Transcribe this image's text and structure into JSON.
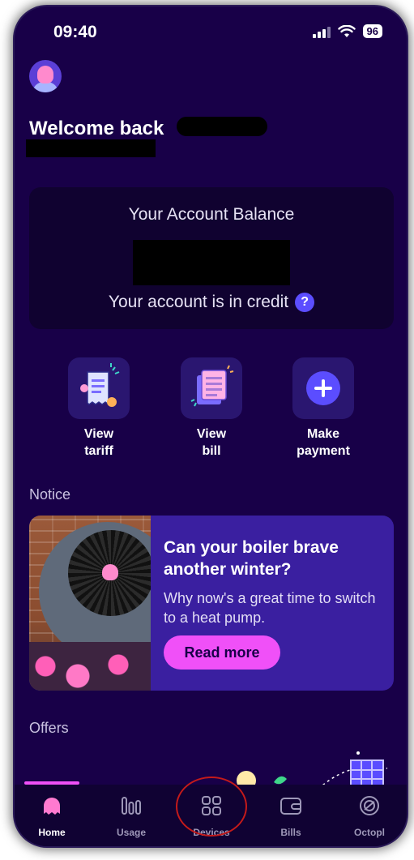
{
  "status_bar": {
    "time": "09:40",
    "battery": "96"
  },
  "header": {
    "welcome_text": "Welcome back"
  },
  "balance_card": {
    "title": "Your Account Balance",
    "status_text": "Your account is in credit",
    "help_icon": "?"
  },
  "quick_actions": [
    {
      "label_line1": "View",
      "label_line2": "tariff",
      "icon": "receipt-icon"
    },
    {
      "label_line1": "View",
      "label_line2": "bill",
      "icon": "bill-document-icon"
    },
    {
      "label_line1": "Make",
      "label_line2": "payment",
      "icon": "plus-circle-icon"
    }
  ],
  "notice": {
    "section_title": "Notice",
    "headline": "Can your boiler brave another winter?",
    "body": "Why now's a great time to switch to a heat pump.",
    "button_label": "Read more"
  },
  "offers": {
    "section_title": "Offers"
  },
  "bottom_nav": [
    {
      "label": "Home",
      "icon": "octopus-home-icon",
      "active": true
    },
    {
      "label": "Usage",
      "icon": "usage-bars-icon",
      "active": false
    },
    {
      "label": "Devices",
      "icon": "devices-grid-icon",
      "active": false
    },
    {
      "label": "Bills",
      "icon": "wallet-icon",
      "active": false
    },
    {
      "label": "Octopl",
      "icon": "octoplus-icon",
      "active": false
    }
  ],
  "colors": {
    "background": "#180048",
    "card": "#100230",
    "accent_pink": "#f050f8",
    "accent_blue": "#5b4dff",
    "annotation_red": "#c41a1a"
  }
}
